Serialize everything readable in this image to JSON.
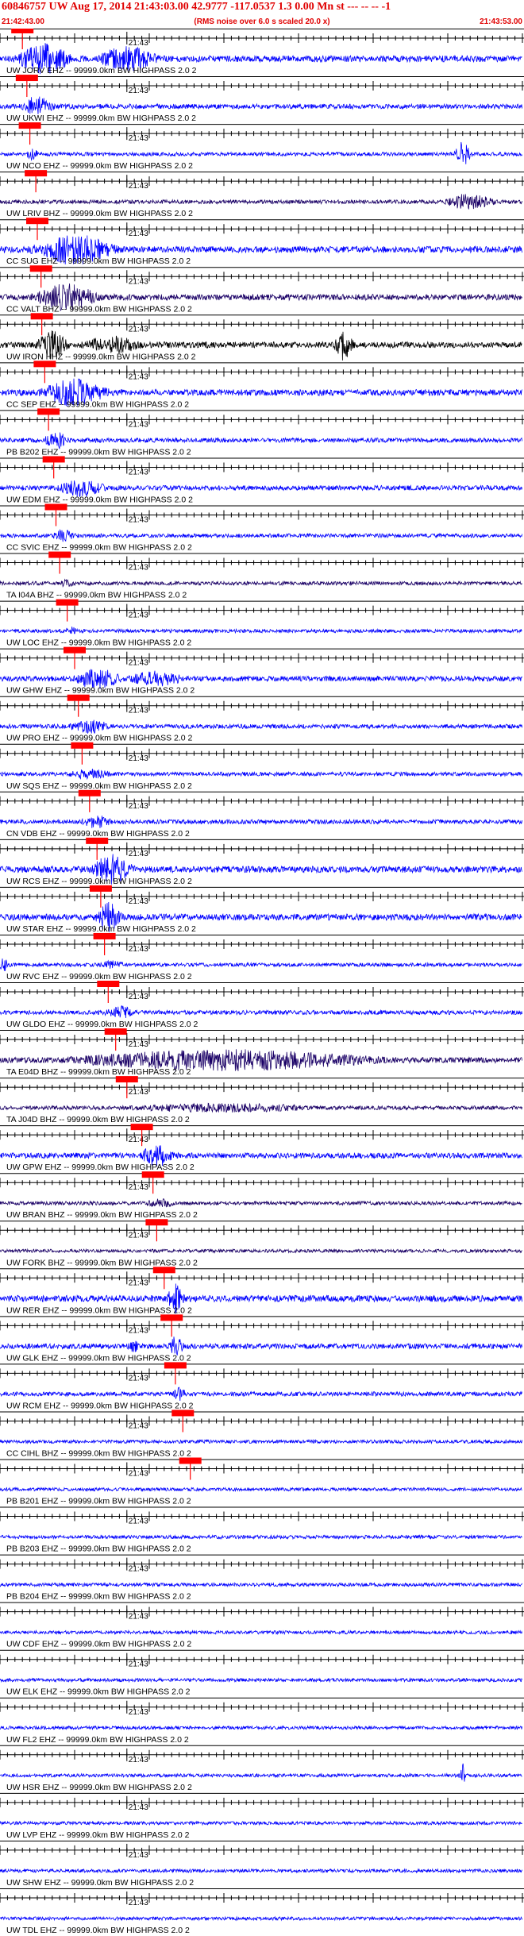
{
  "header": {
    "title": "60846757 UW Aug 17, 2014 21:43:03.00   42.9777 -117.0537  1.3 0.00 Mn st --- -- --  -1",
    "subtitle": "(RMS noise over 6.0 s scaled 20.0 x)",
    "start_time": "21:42:43.00",
    "end_time": "21:43:53.00"
  },
  "colors": {
    "title": "#e00000",
    "pick": "#ff0000",
    "trace_blue": "#0000ff",
    "trace_navy": "#1a0066",
    "trace_black": "#000000"
  },
  "chart_data": {
    "type": "line",
    "title": "60846757 UW Aug 17, 2014 21:43:03.00   42.9777 -117.0537  1.3 0.00 Mn st --- -- --  -1",
    "xlabel": "",
    "ylabel": "",
    "x_range": [
      "21:42:43.00",
      "21:43:53.00"
    ],
    "minute_tick_label": "21:43",
    "minute_tick_seconds": 17,
    "duration_seconds": 70,
    "series": [
      {
        "name": "UW JORV EHZ -- 99999.0km BW  HIGHPASS  2.0  2",
        "color": "#0000ff",
        "pick_seconds": 3.0,
        "amplitude": 0.95,
        "events": [
          [
            6,
            3.5,
            1.0
          ],
          [
            17,
            4.0,
            0.8
          ]
        ]
      },
      {
        "name": "UW UKWI EHZ -- 99999.0km BW  HIGHPASS  2.0  2",
        "color": "#0000ff",
        "pick_seconds": 3.6,
        "amplitude": 0.6,
        "events": [
          [
            5,
            2.0,
            0.7
          ]
        ]
      },
      {
        "name": "UW NCO EHZ -- 99999.0km BW  HIGHPASS  2.0  2",
        "color": "#0000ff",
        "pick_seconds": 4.0,
        "amplitude": 0.3,
        "events": [
          [
            4.5,
            1.0,
            0.4
          ],
          [
            62,
            1.0,
            0.8
          ]
        ]
      },
      {
        "name": "UW LRIV BHZ -- 99999.0km BW  HIGHPASS  2.0  2",
        "color": "#1a0066",
        "pick_seconds": 4.8,
        "amplitude": 0.35,
        "events": [
          [
            63,
            3.0,
            0.6
          ]
        ]
      },
      {
        "name": "CC SUG EHZ -- 99999.0km BW  HIGHPASS  2.0  2",
        "color": "#0000ff",
        "pick_seconds": 5.0,
        "amplitude": 1.0,
        "events": [
          [
            10,
            5.0,
            1.0
          ]
        ]
      },
      {
        "name": "CC VALT BHZ -- 99999.0km BW  HIGHPASS  2.0  2",
        "color": "#1a0066",
        "pick_seconds": 5.5,
        "amplitude": 0.9,
        "events": [
          [
            9,
            4.0,
            0.9
          ]
        ]
      },
      {
        "name": "UW IRON HHZ -- 99999.0km BW  HIGHPASS  2.0  2",
        "color": "#000000",
        "pick_seconds": 5.6,
        "amplitude": 0.9,
        "events": [
          [
            7,
            2.0,
            0.9
          ],
          [
            15,
            4.0,
            0.6
          ],
          [
            46,
            1.2,
            1.0
          ]
        ]
      },
      {
        "name": "CC SEP EHZ -- 99999.0km BW  HIGHPASS  2.0  2",
        "color": "#0000ff",
        "pick_seconds": 6.0,
        "amplitude": 0.95,
        "events": [
          [
            10,
            4.0,
            0.95
          ]
        ]
      },
      {
        "name": "PB B202 EHZ -- 99999.0km BW  HIGHPASS  2.0  2",
        "color": "#0000ff",
        "pick_seconds": 6.5,
        "amplitude": 0.5,
        "events": [
          [
            7.5,
            1.5,
            0.6
          ]
        ]
      },
      {
        "name": "UW EDM EHZ -- 99999.0km BW  HIGHPASS  2.0  2",
        "color": "#0000ff",
        "pick_seconds": 7.2,
        "amplitude": 0.6,
        "events": [
          [
            11,
            3.0,
            0.6
          ]
        ]
      },
      {
        "name": "CC SVIC EHZ -- 99999.0km BW  HIGHPASS  2.0  2",
        "color": "#0000ff",
        "pick_seconds": 7.5,
        "amplitude": 0.35,
        "events": [
          [
            8.5,
            1.5,
            0.4
          ]
        ]
      },
      {
        "name": "TA I04A BHZ -- 99999.0km BW  HIGHPASS  2.0  2",
        "color": "#1a0066",
        "pick_seconds": 8.0,
        "amplitude": 0.3,
        "events": [
          [
            9,
            1.0,
            0.3
          ]
        ]
      },
      {
        "name": "UW LOC EHZ -- 99999.0km BW  HIGHPASS  2.0  2",
        "color": "#0000ff",
        "pick_seconds": 9.0,
        "amplitude": 0.25,
        "events": [
          [
            9.5,
            1.0,
            0.3
          ]
        ]
      },
      {
        "name": "UW GHW EHZ -- 99999.0km BW  HIGHPASS  2.0  2",
        "color": "#0000ff",
        "pick_seconds": 10.0,
        "amplitude": 0.7,
        "events": [
          [
            13,
            3.0,
            0.7
          ],
          [
            21,
            4.0,
            0.5
          ]
        ]
      },
      {
        "name": "UW PRO EHZ -- 99999.0km BW  HIGHPASS  2.0  2",
        "color": "#0000ff",
        "pick_seconds": 10.5,
        "amplitude": 0.45,
        "events": [
          [
            12,
            3.0,
            0.45
          ]
        ]
      },
      {
        "name": "UW SQS EHZ -- 99999.0km BW  HIGHPASS  2.0  2",
        "color": "#0000ff",
        "pick_seconds": 11.0,
        "amplitude": 0.35,
        "events": [
          [
            12,
            3.0,
            0.35
          ]
        ]
      },
      {
        "name": "CN VDB EHZ -- 99999.0km BW  HIGHPASS  2.0  2",
        "color": "#0000ff",
        "pick_seconds": 12.0,
        "amplitude": 0.45,
        "events": [
          [
            13,
            2.0,
            0.45
          ]
        ]
      },
      {
        "name": "UW RCS EHZ -- 99999.0km BW  HIGHPASS  2.0  2",
        "color": "#0000ff",
        "pick_seconds": 13.0,
        "amplitude": 1.0,
        "events": [
          [
            15,
            2.5,
            1.0
          ]
        ]
      },
      {
        "name": "UW STAR EHZ -- 99999.0km BW  HIGHPASS  2.0  2",
        "color": "#0000ff",
        "pick_seconds": 13.5,
        "amplitude": 1.0,
        "events": [
          [
            14.5,
            1.5,
            1.0
          ]
        ]
      },
      {
        "name": "UW RVC EHZ -- 99999.0km BW  HIGHPASS  2.0  2",
        "color": "#0000ff",
        "pick_seconds": 14.0,
        "amplitude": 0.3,
        "events": [
          [
            0.5,
            0.5,
            0.5
          ],
          [
            15,
            2.0,
            0.3
          ]
        ]
      },
      {
        "name": "UW GLDO EHZ -- 99999.0km BW  HIGHPASS  2.0  2",
        "color": "#0000ff",
        "pick_seconds": 14.5,
        "amplitude": 0.45,
        "events": [
          [
            16,
            2.0,
            0.45
          ]
        ]
      },
      {
        "name": "TA E04D BHZ -- 99999.0km BW  HIGHPASS  2.0  2",
        "color": "#1a0066",
        "pick_seconds": 15.5,
        "amplitude": 0.8,
        "events": [
          [
            30,
            20.0,
            0.7
          ]
        ]
      },
      {
        "name": "TA J04D BHZ -- 99999.0km BW  HIGHPASS  2.0  2",
        "color": "#1a0066",
        "pick_seconds": 17.0,
        "amplitude": 0.35,
        "events": [
          [
            30,
            15.0,
            0.3
          ]
        ]
      },
      {
        "name": "UW GPW EHZ -- 99999.0km BW  HIGHPASS  2.0  2",
        "color": "#0000ff",
        "pick_seconds": 19.0,
        "amplitude": 0.75,
        "events": [
          [
            21,
            2.0,
            0.75
          ]
        ]
      },
      {
        "name": "UW BRAN BHZ -- 99999.0km BW  HIGHPASS  2.0  2",
        "color": "#1a0066",
        "pick_seconds": 20.5,
        "amplitude": 0.3,
        "events": [
          [
            21.5,
            2.0,
            0.3
          ]
        ]
      },
      {
        "name": "UW FORK BHZ -- 99999.0km BW  HIGHPASS  2.0  2",
        "color": "#1a0066",
        "pick_seconds": 21.0,
        "amplitude": 0.2,
        "events": []
      },
      {
        "name": "UW RER EHZ -- 99999.0km BW  HIGHPASS  2.0  2",
        "color": "#0000ff",
        "pick_seconds": 22.0,
        "amplitude": 1.0,
        "events": [
          [
            23.5,
            1.0,
            1.0
          ]
        ]
      },
      {
        "name": "UW GLK EHZ -- 99999.0km BW  HIGHPASS  2.0  2",
        "color": "#0000ff",
        "pick_seconds": 23.0,
        "amplitude": 0.7,
        "events": [
          [
            23.5,
            1.0,
            0.7
          ],
          [
            18,
            1.0,
            0.4
          ]
        ]
      },
      {
        "name": "UW RCM EHZ -- 99999.0km BW  HIGHPASS  2.0  2",
        "color": "#0000ff",
        "pick_seconds": 23.5,
        "amplitude": 0.45,
        "events": [
          [
            24,
            1.0,
            0.45
          ]
        ]
      },
      {
        "name": "CC CIHL BHZ -- 99999.0km BW  HIGHPASS  2.0  2",
        "color": "#0000ff",
        "pick_seconds": 24.5,
        "amplitude": 0.2,
        "events": []
      },
      {
        "name": "PB B201 EHZ -- 99999.0km BW  HIGHPASS  2.0  2",
        "color": "#0000ff",
        "pick_seconds": 25.5,
        "amplitude": 0.2,
        "events": []
      },
      {
        "name": "PB B203 EHZ -- 99999.0km BW  HIGHPASS  2.0  2",
        "color": "#0000ff",
        "pick_seconds": null,
        "amplitude": 0.25,
        "events": []
      },
      {
        "name": "PB B204 EHZ -- 99999.0km BW  HIGHPASS  2.0  2",
        "color": "#0000ff",
        "pick_seconds": null,
        "amplitude": 0.25,
        "events": []
      },
      {
        "name": "UW CDF EHZ -- 99999.0km BW  HIGHPASS  2.0  2",
        "color": "#0000ff",
        "pick_seconds": null,
        "amplitude": 0.2,
        "events": []
      },
      {
        "name": "UW ELK EHZ -- 99999.0km BW  HIGHPASS  2.0  2",
        "color": "#0000ff",
        "pick_seconds": null,
        "amplitude": 0.2,
        "events": []
      },
      {
        "name": "UW FL2 EHZ -- 99999.0km BW  HIGHPASS  2.0  2",
        "color": "#0000ff",
        "pick_seconds": null,
        "amplitude": 0.2,
        "events": []
      },
      {
        "name": "UW HSR EHZ -- 99999.0km BW  HIGHPASS  2.0  2",
        "color": "#0000ff",
        "pick_seconds": null,
        "amplitude": 0.2,
        "events": [
          [
            62,
            0.3,
            0.8
          ]
        ]
      },
      {
        "name": "UW LVP EHZ -- 99999.0km BW  HIGHPASS  2.0  2",
        "color": "#0000ff",
        "pick_seconds": null,
        "amplitude": 0.2,
        "events": []
      },
      {
        "name": "UW SHW EHZ -- 99999.0km BW  HIGHPASS  2.0  2",
        "color": "#0000ff",
        "pick_seconds": null,
        "amplitude": 0.2,
        "events": []
      },
      {
        "name": "UW TDL EHZ -- 99999.0km BW  HIGHPASS  2.0  2",
        "color": "#0000ff",
        "pick_seconds": null,
        "amplitude": 0.2,
        "events": []
      }
    ]
  }
}
